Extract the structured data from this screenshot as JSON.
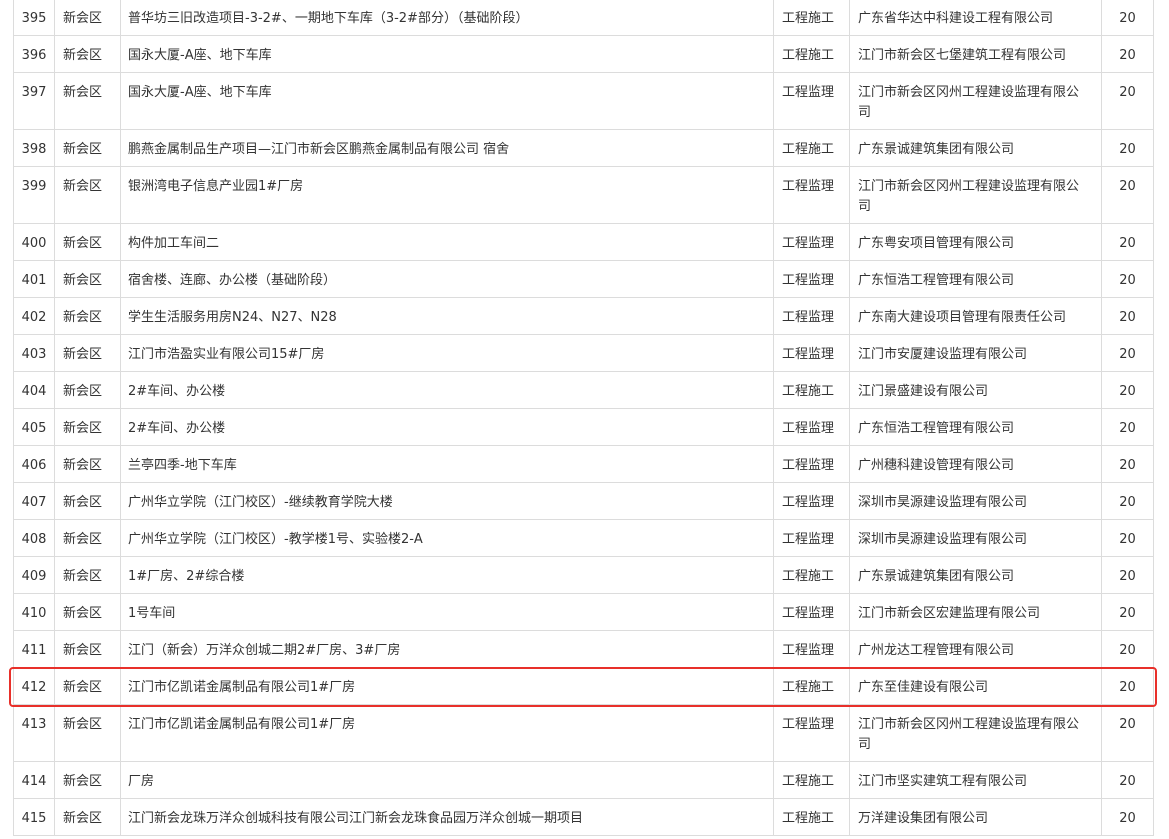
{
  "rows": [
    {
      "no": "395",
      "district": "新会区",
      "project": "普华坊三旧改造项目-3-2#、一期地下车库（3-2#部分）（基础阶段）",
      "type": "工程施工",
      "company": "广东省华达中科建设工程有限公司",
      "score": "20"
    },
    {
      "no": "396",
      "district": "新会区",
      "project": "国永大厦-A座、地下车库",
      "type": "工程施工",
      "company": "江门市新会区七堡建筑工程有限公司",
      "score": "20"
    },
    {
      "no": "397",
      "district": "新会区",
      "project": "国永大厦-A座、地下车库",
      "type": "工程监理",
      "company": "江门市新会区冈州工程建设监理有限公司",
      "score": "20"
    },
    {
      "no": "398",
      "district": "新会区",
      "project": "鹏燕金属制品生产项目—江门市新会区鹏燕金属制品有限公司 宿舍",
      "type": "工程施工",
      "company": "广东景诚建筑集团有限公司",
      "score": "20"
    },
    {
      "no": "399",
      "district": "新会区",
      "project": "银洲湾电子信息产业园1#厂房",
      "type": "工程监理",
      "company": "江门市新会区冈州工程建设监理有限公司",
      "score": "20"
    },
    {
      "no": "400",
      "district": "新会区",
      "project": "构件加工车间二",
      "type": "工程监理",
      "company": "广东粤安项目管理有限公司",
      "score": "20"
    },
    {
      "no": "401",
      "district": "新会区",
      "project": "宿舍楼、连廊、办公楼（基础阶段）",
      "type": "工程监理",
      "company": "广东恒浩工程管理有限公司",
      "score": "20"
    },
    {
      "no": "402",
      "district": "新会区",
      "project": "学生生活服务用房N24、N27、N28",
      "type": "工程监理",
      "company": "广东南大建设项目管理有限责任公司",
      "score": "20"
    },
    {
      "no": "403",
      "district": "新会区",
      "project": "江门市浩盈实业有限公司15#厂房",
      "type": "工程监理",
      "company": "江门市安厦建设监理有限公司",
      "score": "20"
    },
    {
      "no": "404",
      "district": "新会区",
      "project": "2#车间、办公楼",
      "type": "工程施工",
      "company": "江门景盛建设有限公司",
      "score": "20"
    },
    {
      "no": "405",
      "district": "新会区",
      "project": "2#车间、办公楼",
      "type": "工程监理",
      "company": "广东恒浩工程管理有限公司",
      "score": "20"
    },
    {
      "no": "406",
      "district": "新会区",
      "project": "兰亭四季-地下车库",
      "type": "工程监理",
      "company": "广州穗科建设管理有限公司",
      "score": "20"
    },
    {
      "no": "407",
      "district": "新会区",
      "project": "广州华立学院（江门校区）-继续教育学院大楼",
      "type": "工程监理",
      "company": "深圳市昊源建设监理有限公司",
      "score": "20"
    },
    {
      "no": "408",
      "district": "新会区",
      "project": "广州华立学院（江门校区）-教学楼1号、实验楼2-A",
      "type": "工程监理",
      "company": "深圳市昊源建设监理有限公司",
      "score": "20"
    },
    {
      "no": "409",
      "district": "新会区",
      "project": "1#厂房、2#综合楼",
      "type": "工程施工",
      "company": "广东景诚建筑集团有限公司",
      "score": "20"
    },
    {
      "no": "410",
      "district": "新会区",
      "project": "1号车间",
      "type": "工程监理",
      "company": "江门市新会区宏建监理有限公司",
      "score": "20"
    },
    {
      "no": "411",
      "district": "新会区",
      "project": "江门（新会）万洋众创城二期2#厂房、3#厂房",
      "type": "工程监理",
      "company": "广州龙达工程管理有限公司",
      "score": "20"
    },
    {
      "no": "412",
      "district": "新会区",
      "project": "江门市亿凯诺金属制品有限公司1#厂房",
      "type": "工程施工",
      "company": "广东至佳建设有限公司",
      "score": "20"
    },
    {
      "no": "413",
      "district": "新会区",
      "project": "江门市亿凯诺金属制品有限公司1#厂房",
      "type": "工程监理",
      "company": "江门市新会区冈州工程建设监理有限公司",
      "score": "20"
    },
    {
      "no": "414",
      "district": "新会区",
      "project": "厂房",
      "type": "工程施工",
      "company": "江门市坚实建筑工程有限公司",
      "score": "20"
    },
    {
      "no": "415",
      "district": "新会区",
      "project": "江门新会龙珠万洋众创城科技有限公司江门新会龙珠食品园万洋众创城一期项目",
      "type": "工程施工",
      "company": "万洋建设集团有限公司",
      "score": "20"
    }
  ],
  "highlight": {
    "row_no": "412",
    "color": "#e8302a"
  }
}
